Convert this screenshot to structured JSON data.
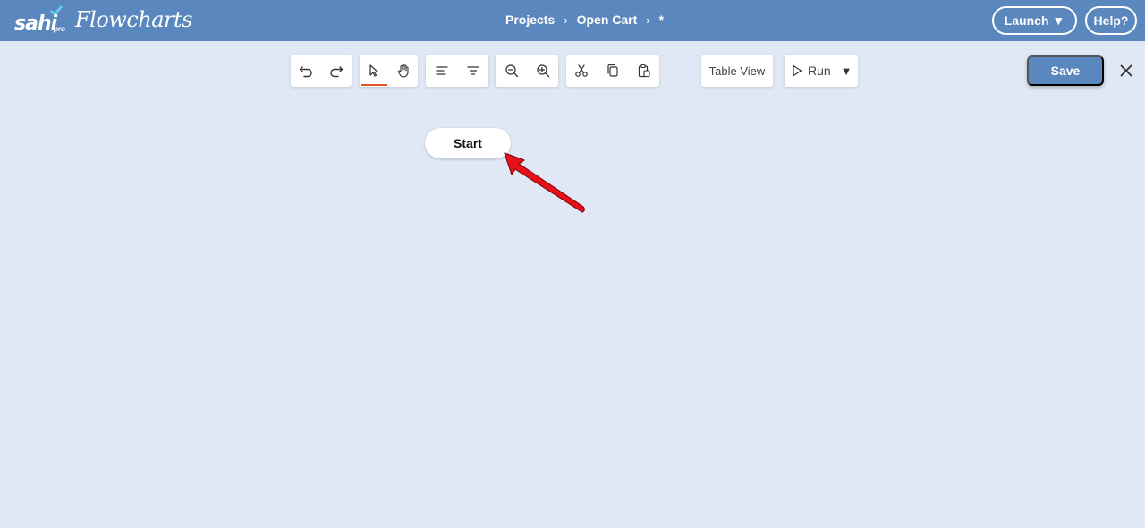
{
  "header": {
    "logo": {
      "brand": "sahi",
      "sub": "pro",
      "product": "Flowcharts"
    },
    "breadcrumb": [
      {
        "label": "Projects"
      },
      {
        "label": "Open Cart"
      },
      {
        "label": "*"
      }
    ],
    "separator": "›",
    "launch_label": "Launch ▼",
    "help_label": "Help?"
  },
  "toolbar": {
    "groups": [
      [
        {
          "icon": "undo-icon"
        },
        {
          "icon": "redo-icon"
        }
      ],
      [
        {
          "icon": "pointer-icon",
          "active": true
        },
        {
          "icon": "hand-icon"
        }
      ],
      [
        {
          "icon": "align-left-icon"
        },
        {
          "icon": "filter-icon"
        }
      ],
      [
        {
          "icon": "zoom-out-icon"
        },
        {
          "icon": "zoom-in-icon"
        }
      ],
      [
        {
          "icon": "cut-icon"
        },
        {
          "icon": "copy-icon"
        },
        {
          "icon": "paste-icon"
        }
      ]
    ],
    "table_view_label": "Table View",
    "run_label": "Run",
    "run_caret": "▼",
    "save_label": "Save",
    "close_icon": "close-icon"
  },
  "canvas": {
    "start_node_label": "Start",
    "annotation": "red-arrow-icon"
  },
  "colors": {
    "header_bg": "#5a87bd",
    "canvas_bg": "#dfe8f4",
    "active_underline": "#e0542d",
    "arrow": "#e8101a"
  }
}
